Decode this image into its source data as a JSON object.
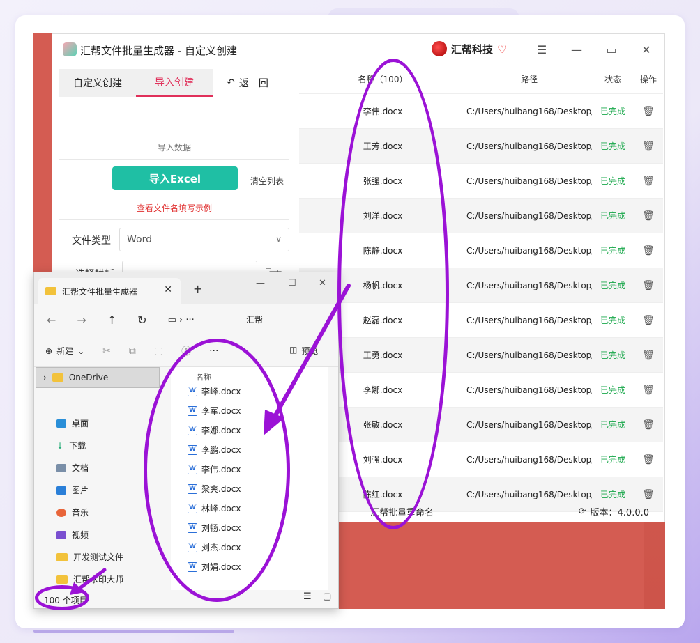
{
  "app": {
    "title": "汇帮文件批量生成器 - 自定义创建",
    "brand": "汇帮科技",
    "tabs": [
      "自定义创建",
      "导入创建"
    ],
    "back_label": "返　回",
    "section_label": "导入数据",
    "import_button": "导入Excel",
    "clear_button": "清空列表",
    "example_link": "查看文件名填写示例",
    "file_type_label": "文件类型",
    "file_type_value": "Word",
    "template_label": "选择模板",
    "table": {
      "headers": [
        "名称（100）",
        "路径",
        "状态",
        "操作"
      ],
      "rows": [
        {
          "name": "李伟.docx",
          "path": "C:/Users/huibang168/Desktop/",
          "status": "已完成"
        },
        {
          "name": "王芳.docx",
          "path": "C:/Users/huibang168/Desktop/",
          "status": "已完成"
        },
        {
          "name": "张强.docx",
          "path": "C:/Users/huibang168/Desktop/",
          "status": "已完成"
        },
        {
          "name": "刘洋.docx",
          "path": "C:/Users/huibang168/Desktop/",
          "status": "已完成"
        },
        {
          "name": "陈静.docx",
          "path": "C:/Users/huibang168/Desktop/",
          "status": "已完成"
        },
        {
          "name": "杨帆.docx",
          "path": "C:/Users/huibang168/Desktop/",
          "status": "已完成"
        },
        {
          "name": "赵磊.docx",
          "path": "C:/Users/huibang168/Desktop/",
          "status": "已完成"
        },
        {
          "name": "王勇.docx",
          "path": "C:/Users/huibang168/Desktop/",
          "status": "已完成"
        },
        {
          "name": "李娜.docx",
          "path": "C:/Users/huibang168/Desktop/",
          "status": "已完成"
        },
        {
          "name": "张敏.docx",
          "path": "C:/Users/huibang168/Desktop/",
          "status": "已完成"
        },
        {
          "name": "刘强.docx",
          "path": "C:/Users/huibang168/Desktop/",
          "status": "已完成"
        },
        {
          "name": "陈红.docx",
          "path": "C:/Users/huibang168/Desktop/",
          "status": "已完成"
        }
      ]
    },
    "footer_rename": "汇帮批量重命名",
    "version": "版本：4.0.0.0"
  },
  "explorer": {
    "tab_title": "汇帮文件批量生成器",
    "path_text": "汇帮",
    "new_label": "新建",
    "preview_label": "预览",
    "onedrive": "OneDrive",
    "nav": [
      "桌面",
      "下载",
      "文档",
      "图片",
      "音乐",
      "视频",
      "开发测试文件",
      "汇帮水印大师"
    ],
    "column_name": "名称",
    "files": [
      "李峰.docx",
      "李军.docx",
      "李娜.docx",
      "李鹏.docx",
      "李伟.docx",
      "梁爽.docx",
      "林峰.docx",
      "刘畅.docx",
      "刘杰.docx",
      "刘娟.docx"
    ],
    "status": "100 个项目"
  },
  "colors": {
    "accent": "#e0305a",
    "primary": "#1fbfa4",
    "success": "#1aa84b",
    "annotation": "#9b12d6"
  }
}
